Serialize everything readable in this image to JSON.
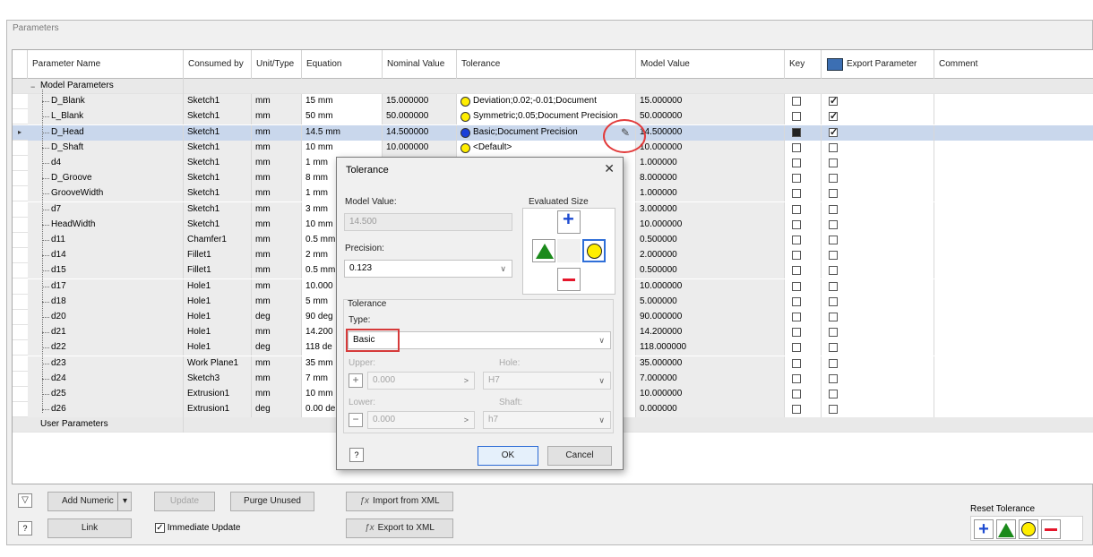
{
  "window": {
    "title": "Parameters"
  },
  "columns": [
    "Parameter Name",
    "Consumed by",
    "Unit/Type",
    "Equation",
    "Nominal Value",
    "Tolerance",
    "Model Value",
    "Key",
    "Export Parameter",
    "Comment"
  ],
  "groups": {
    "model": "Model Parameters",
    "user": "User Parameters"
  },
  "rows": [
    {
      "name": "D_Blank",
      "consumed": "Sketch1",
      "unit": "mm",
      "eq": "15 mm",
      "nominal": "15.000000",
      "tol": "Deviation;0.02;-0.01;Document",
      "tol_color": "#ffee00",
      "model": "15.000000",
      "key": false,
      "export": true
    },
    {
      "name": "L_Blank",
      "consumed": "Sketch1",
      "unit": "mm",
      "eq": "50 mm",
      "nominal": "50.000000",
      "tol": "Symmetric;0.05;Document Precision",
      "tol_color": "#ffee00",
      "model": "50.000000",
      "key": false,
      "export": true
    },
    {
      "name": "D_Head",
      "consumed": "Sketch1",
      "unit": "mm",
      "eq": "14.5 mm",
      "nominal": "14.500000",
      "tol": "Basic;Document Precision",
      "tol_color": "#1a3fd9",
      "model": "14.500000",
      "key": true,
      "export": true
    },
    {
      "name": "D_Shaft",
      "consumed": "Sketch1",
      "unit": "mm",
      "eq": "10 mm",
      "nominal": "10.000000",
      "tol": "<Default>",
      "tol_color": "#ffee00",
      "model": "10.000000",
      "key": false,
      "export": false
    },
    {
      "name": "d4",
      "consumed": "Sketch1",
      "unit": "mm",
      "eq": "1 mm",
      "nominal": "",
      "tol": "",
      "tol_color": "",
      "model": "1.000000",
      "key": false,
      "export": false
    },
    {
      "name": "D_Groove",
      "consumed": "Sketch1",
      "unit": "mm",
      "eq": "8 mm",
      "nominal": "",
      "tol": "",
      "tol_color": "",
      "model": "8.000000",
      "key": false,
      "export": false
    },
    {
      "name": "GrooveWidth",
      "consumed": "Sketch1",
      "unit": "mm",
      "eq": "1 mm",
      "nominal": "",
      "tol": "",
      "tol_color": "",
      "model": "1.000000",
      "key": false,
      "export": false
    },
    {
      "name": "d7",
      "consumed": "Sketch1",
      "unit": "mm",
      "eq": "3 mm",
      "nominal": "",
      "tol": "",
      "tol_color": "",
      "model": "3.000000",
      "key": false,
      "export": false
    },
    {
      "name": "HeadWidth",
      "consumed": "Sketch1",
      "unit": "mm",
      "eq": "10 mm",
      "nominal": "",
      "tol": "",
      "tol_color": "",
      "model": "10.000000",
      "key": false,
      "export": false
    },
    {
      "name": "d11",
      "consumed": "Chamfer1",
      "unit": "mm",
      "eq": "0.5 mm",
      "nominal": "",
      "tol": "",
      "tol_color": "",
      "model": "0.500000",
      "key": false,
      "export": false
    },
    {
      "name": "d14",
      "consumed": "Fillet1",
      "unit": "mm",
      "eq": "2 mm",
      "nominal": "",
      "tol": "",
      "tol_color": "",
      "model": "2.000000",
      "key": false,
      "export": false
    },
    {
      "name": "d15",
      "consumed": "Fillet1",
      "unit": "mm",
      "eq": "0.5 mm",
      "nominal": "",
      "tol": "",
      "tol_color": "",
      "model": "0.500000",
      "key": false,
      "export": false
    },
    {
      "name": "d17",
      "consumed": "Hole1",
      "unit": "mm",
      "eq": "10.000",
      "nominal": "",
      "tol": "",
      "tol_color": "",
      "model": "10.000000",
      "key": false,
      "export": false
    },
    {
      "name": "d18",
      "consumed": "Hole1",
      "unit": "mm",
      "eq": "5 mm",
      "nominal": "",
      "tol": "",
      "tol_color": "",
      "model": "5.000000",
      "key": false,
      "export": false
    },
    {
      "name": "d20",
      "consumed": "Hole1",
      "unit": "deg",
      "eq": "90 deg",
      "nominal": "",
      "tol": "",
      "tol_color": "",
      "model": "90.000000",
      "key": false,
      "export": false
    },
    {
      "name": "d21",
      "consumed": "Hole1",
      "unit": "mm",
      "eq": "14.200",
      "nominal": "",
      "tol": "",
      "tol_color": "",
      "model": "14.200000",
      "key": false,
      "export": false
    },
    {
      "name": "d22",
      "consumed": "Hole1",
      "unit": "deg",
      "eq": "118 de",
      "nominal": "",
      "tol": "",
      "tol_color": "",
      "model": "118.000000",
      "key": false,
      "export": false
    },
    {
      "name": "d23",
      "consumed": "Work Plane1",
      "unit": "mm",
      "eq": "35 mm",
      "nominal": "",
      "tol": "",
      "tol_color": "",
      "model": "35.000000",
      "key": false,
      "export": false
    },
    {
      "name": "d24",
      "consumed": "Sketch3",
      "unit": "mm",
      "eq": "7 mm",
      "nominal": "",
      "tol": "",
      "tol_color": "",
      "model": "7.000000",
      "key": false,
      "export": false
    },
    {
      "name": "d25",
      "consumed": "Extrusion1",
      "unit": "mm",
      "eq": "10 mm",
      "nominal": "",
      "tol": "",
      "tol_color": "",
      "model": "10.000000",
      "key": false,
      "export": false
    },
    {
      "name": "d26",
      "consumed": "Extrusion1",
      "unit": "deg",
      "eq": "0.00 de",
      "nominal": "",
      "tol": "",
      "tol_color": "",
      "model": "0.000000",
      "key": false,
      "export": false
    }
  ],
  "dialog": {
    "title": "Tolerance",
    "close": "✕",
    "model_value_label": "Model Value:",
    "model_value": "14.500",
    "precision_label": "Precision:",
    "precision": "0.123",
    "evaluated_size_label": "Evaluated Size",
    "tolerance_group": "Tolerance",
    "type_label": "Type:",
    "type_value": "Basic",
    "upper_label": "Upper:",
    "upper_value": "0.000",
    "hole_label": "Hole:",
    "hole_value": "H7",
    "lower_label": "Lower:",
    "lower_value": "0.000",
    "shaft_label": "Shaft:",
    "shaft_value": "h7",
    "ok": "OK",
    "cancel": "Cancel"
  },
  "toolbar": {
    "add_numeric": "Add Numeric",
    "update": "Update",
    "purge_unused": "Purge Unused",
    "import_xml": "Import from XML",
    "link": "Link",
    "immediate_update": "Immediate Update",
    "export_xml": "Export to XML",
    "reset_tolerance": "Reset Tolerance"
  },
  "colors": {
    "selected_row": "#c9d7ec",
    "highlight_red": "#e23b3b",
    "accent_blue": "#1f4cd1",
    "green": "#1b8a1b",
    "yellow": "#ffee00",
    "minus_red": "#e5162b"
  }
}
